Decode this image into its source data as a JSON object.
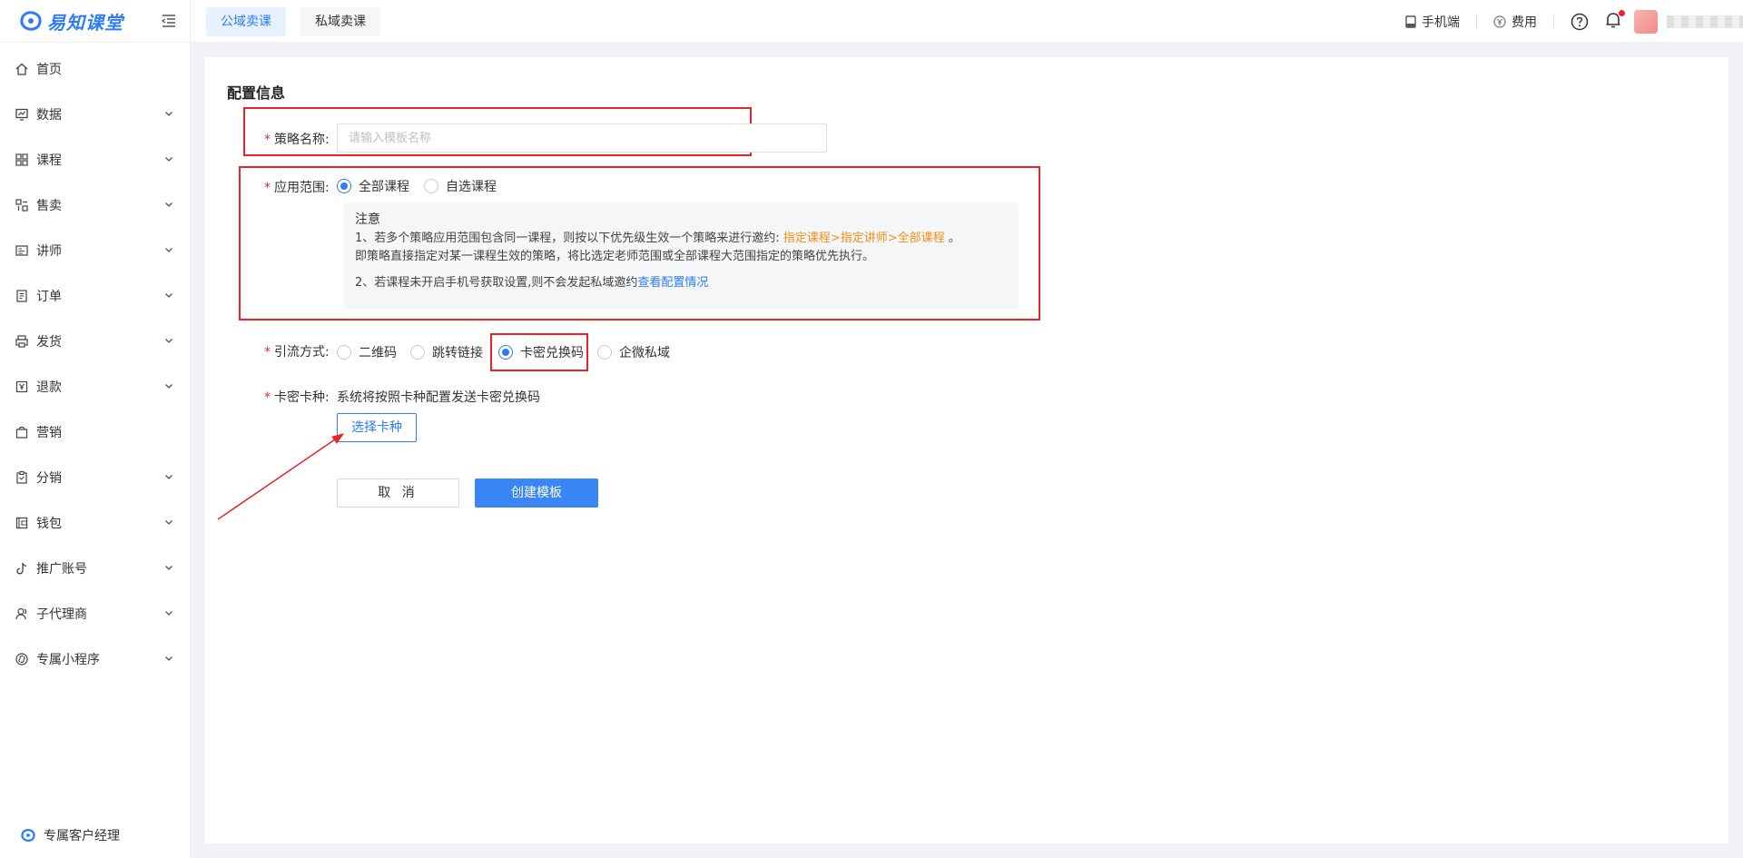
{
  "brand": {
    "logo_text": "易知课堂"
  },
  "sidebar": {
    "items": [
      {
        "label": "首页",
        "icon": "home-icon",
        "expandable": false
      },
      {
        "label": "数据",
        "icon": "chart-icon",
        "expandable": true
      },
      {
        "label": "课程",
        "icon": "grid-icon",
        "expandable": true
      },
      {
        "label": "售卖",
        "icon": "shop-icon",
        "expandable": true
      },
      {
        "label": "讲师",
        "icon": "teacher-icon",
        "expandable": true
      },
      {
        "label": "订单",
        "icon": "order-icon",
        "expandable": true
      },
      {
        "label": "发货",
        "icon": "printer-icon",
        "expandable": true
      },
      {
        "label": "退款",
        "icon": "refund-icon",
        "expandable": true
      },
      {
        "label": "营销",
        "icon": "bag-icon",
        "expandable": false
      },
      {
        "label": "分销",
        "icon": "clipboard-icon",
        "expandable": true
      },
      {
        "label": "钱包",
        "icon": "wallet-icon",
        "expandable": true
      },
      {
        "label": "推广账号",
        "icon": "tiktok-icon",
        "expandable": true
      },
      {
        "label": "子代理商",
        "icon": "user-icon",
        "expandable": true
      },
      {
        "label": "专属小程序",
        "icon": "miniprogram-icon",
        "expandable": true
      }
    ],
    "account_manager": "专属客户经理"
  },
  "topbar": {
    "tabs": [
      {
        "label": "公域卖课",
        "active": true
      },
      {
        "label": "私域卖课",
        "active": false
      }
    ],
    "mobile_label": "手机端",
    "fee_label": "费用"
  },
  "form": {
    "section_title": "配置信息",
    "strategy_name": {
      "label": "策略名称:",
      "placeholder": "请输入模板名称",
      "value": ""
    },
    "scope": {
      "label": "应用范围:",
      "options": [
        "全部课程",
        "自选课程"
      ],
      "selected": "全部课程"
    },
    "notice": {
      "title": "注意",
      "line1_prefix": "1、若多个策略应用范围包含同一课程，则按以下优先级生效一个策略来进行邀约: ",
      "line1_highlight": "指定课程>指定讲师>全部课程",
      "line1_suffix": " 。",
      "line1_cont": "即策略直接指定对某一课程生效的策略，将比选定老师范围或全部课程大范围指定的策略优先执行。",
      "line2_prefix": "2、若课程未开启手机号获取设置,则不会发起私域邀约",
      "line2_link": "查看配置情况"
    },
    "method": {
      "label": "引流方式:",
      "options": [
        "二维码",
        "跳转链接",
        "卡密兑换码",
        "企微私域"
      ],
      "selected": "卡密兑换码"
    },
    "card_type": {
      "label": "卡密卡种:",
      "description": "系统将按照卡种配置发送卡密兑换码",
      "select_button": "选择卡种"
    },
    "actions": {
      "cancel": "取 消",
      "create": "创建模板"
    }
  },
  "colors": {
    "accent": "#2f7cf6",
    "annotation_red": "#e32727",
    "highlight_orange": "#fa8c16"
  }
}
